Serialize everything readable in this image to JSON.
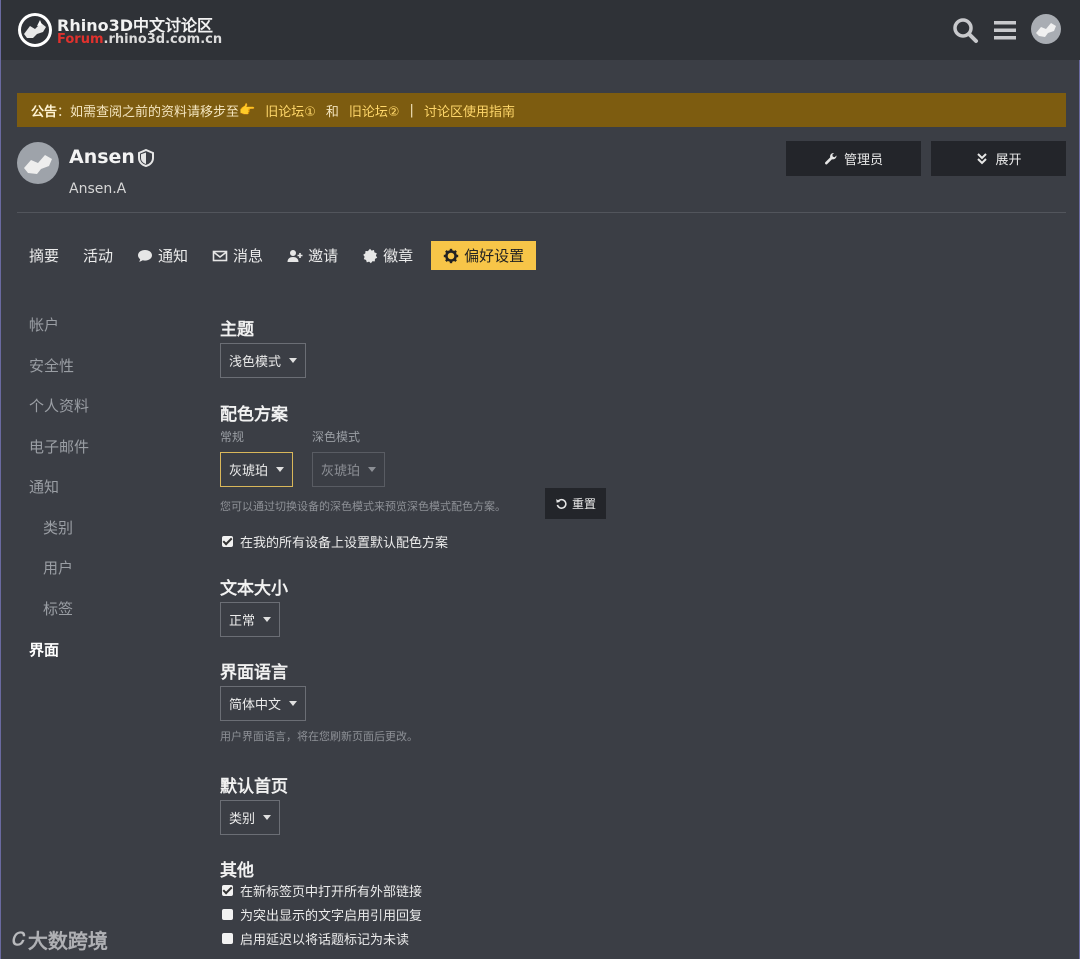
{
  "header": {
    "title": "Rhino3D中文讨论区",
    "subtitle_accent": "Forum",
    "subtitle_rest": ".rhino3d.com.cn",
    "icons": [
      "search-icon",
      "hamburger-menu-icon",
      "user-avatar"
    ]
  },
  "announcement": {
    "label": "公告",
    "text": "：如需查阅之前的资料请移步至",
    "emoji": "👉",
    "link1": "旧论坛①",
    "and": "和",
    "link2": "旧论坛②",
    "sep": "|",
    "link3": "讨论区使用指南"
  },
  "profile": {
    "name": "Ansen",
    "username": "Ansen.A",
    "admin_button": "管理员",
    "expand_button": "展开"
  },
  "tabs": [
    {
      "label": "摘要",
      "icon": ""
    },
    {
      "label": "活动",
      "icon": ""
    },
    {
      "label": "通知",
      "icon": "comment-icon"
    },
    {
      "label": "消息",
      "icon": "envelope-icon"
    },
    {
      "label": "邀请",
      "icon": "user-plus-icon"
    },
    {
      "label": "徽章",
      "icon": "certificate-icon"
    },
    {
      "label": "偏好设置",
      "icon": "gear-icon",
      "active": true
    }
  ],
  "sidenav": {
    "items": [
      "帐户",
      "安全性",
      "个人资料",
      "电子邮件",
      "通知",
      "类别",
      "用户",
      "标签",
      "界面"
    ],
    "active": "界面"
  },
  "theme": {
    "title": "主题",
    "value": "浅色模式"
  },
  "color_scheme": {
    "title": "配色方案",
    "regular_label": "常规",
    "dark_label": "深色模式",
    "regular_value": "灰琥珀",
    "dark_value": "灰琥珀",
    "help": "您可以通过切换设备的深色模式来预览深色模式配色方案。",
    "reset": "重置",
    "default_all_devices": "在我的所有设备上设置默认配色方案"
  },
  "text_size": {
    "title": "文本大小",
    "value": "正常"
  },
  "language": {
    "title": "界面语言",
    "value": "简体中文",
    "help": "用户界面语言，将在您刷新页面后更改。"
  },
  "homepage": {
    "title": "默认首页",
    "value": "类别"
  },
  "other": {
    "title": "其他",
    "options": [
      {
        "label": "在新标签页中打开所有外部链接",
        "checked": true
      },
      {
        "label": "为突出显示的文字启用引用回复",
        "checked": false
      },
      {
        "label": "启用延迟以将话题标记为未读",
        "checked": false
      }
    ]
  },
  "watermark": {
    "mark": "Ꮯ",
    "text": "大数跨境"
  },
  "colors": {
    "accent": "#f7c548",
    "announcement_bg": "#7d5c10",
    "background": "#3b3e45"
  }
}
